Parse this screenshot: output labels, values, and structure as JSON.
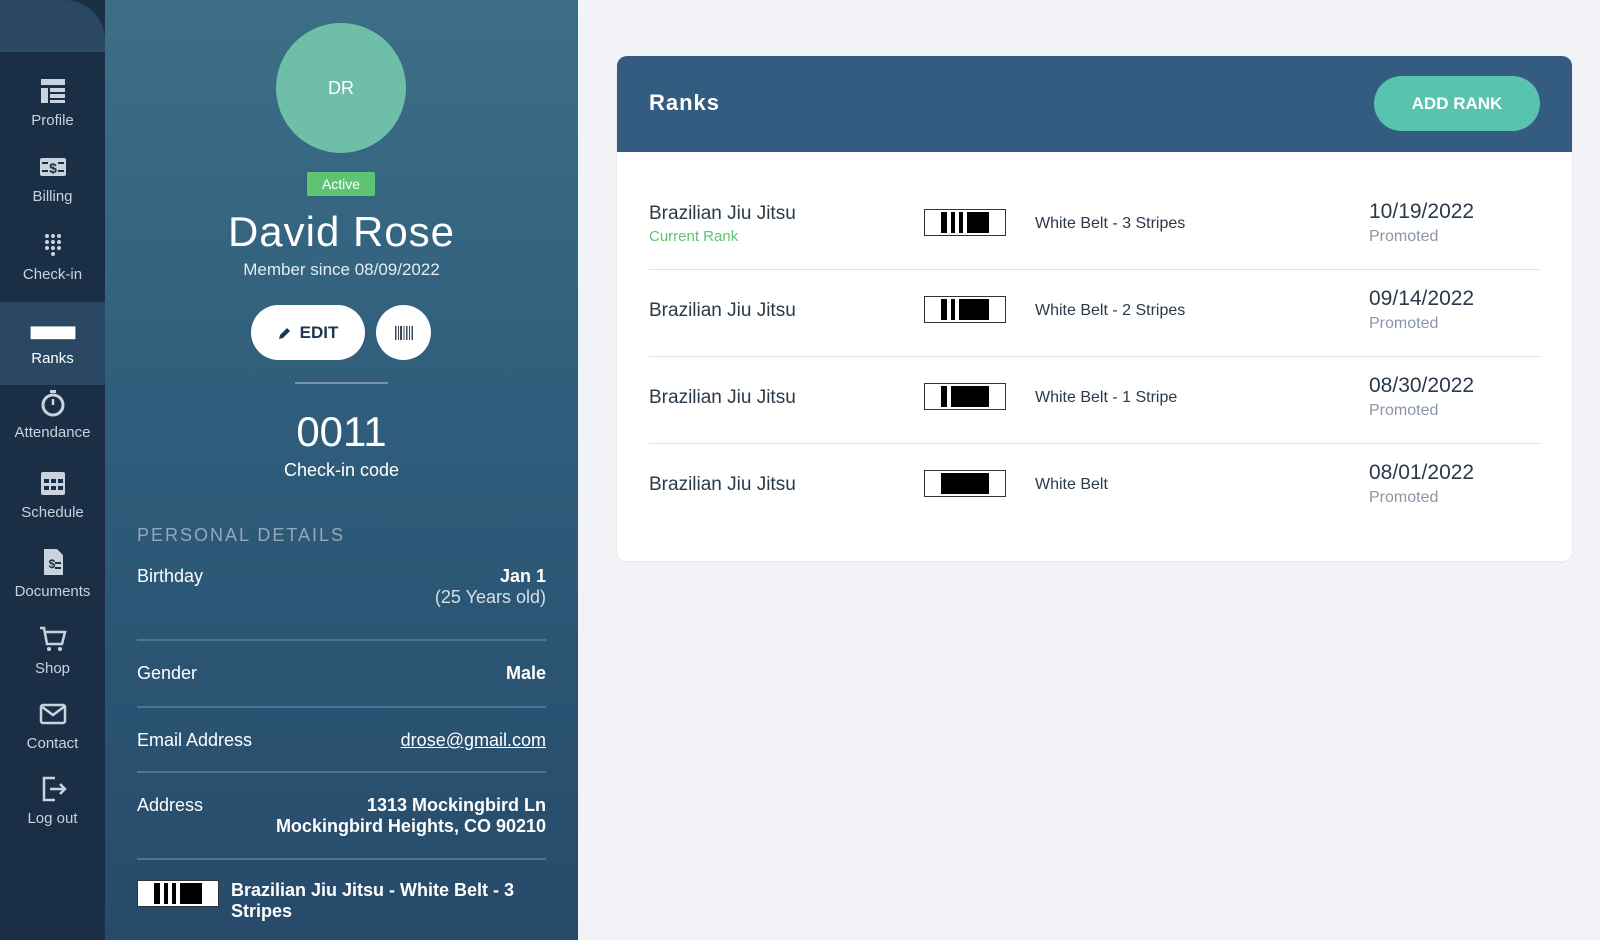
{
  "nav": {
    "items": [
      {
        "label": "Profile",
        "icon": "profile-icon"
      },
      {
        "label": "Billing",
        "icon": "billing-icon"
      },
      {
        "label": "Check-in",
        "icon": "keypad-icon"
      },
      {
        "label": "Ranks",
        "icon": "belt-icon"
      },
      {
        "label": "Attendance",
        "icon": "stopwatch-icon"
      },
      {
        "label": "Schedule",
        "icon": "calendar-icon"
      },
      {
        "label": "Documents",
        "icon": "document-icon"
      },
      {
        "label": "Shop",
        "icon": "cart-icon"
      },
      {
        "label": "Contact",
        "icon": "envelope-icon"
      },
      {
        "label": "Log out",
        "icon": "logout-icon"
      }
    ],
    "active": "Ranks"
  },
  "profile": {
    "initials": "DR",
    "status": "Active",
    "name": "David Rose",
    "member_since": "Member since 08/09/2022",
    "edit_label": "EDIT",
    "checkin_code": "0011",
    "checkin_label": "Check-in code",
    "section_heading": "PERSONAL DETAILS",
    "birthday_label": "Birthday",
    "birthday_value": "Jan 1",
    "birthday_age": "(25 Years old)",
    "gender_label": "Gender",
    "gender_value": "Male",
    "email_label": "Email Address",
    "email_value": "drose@gmail.com",
    "address_label": "Address",
    "address_line1": "1313 Mockingbird Ln",
    "address_line2": "Mockingbird Heights, CO 90210",
    "rank_summary": "Brazilian Jiu Jitsu - White Belt - 3 Stripes",
    "rank_summary_stripes": 3
  },
  "ranks_card": {
    "title": "Ranks",
    "add_button": "ADD RANK",
    "rows": [
      {
        "program": "Brazilian Jiu Jitsu",
        "current_label": "Current Rank",
        "belt_name": "White Belt - 3 Stripes",
        "stripes": 3,
        "date": "10/19/2022",
        "status": "Promoted"
      },
      {
        "program": "Brazilian Jiu Jitsu",
        "belt_name": "White Belt - 2 Stripes",
        "stripes": 2,
        "date": "09/14/2022",
        "status": "Promoted"
      },
      {
        "program": "Brazilian Jiu Jitsu",
        "belt_name": "White Belt - 1 Stripe",
        "stripes": 1,
        "date": "08/30/2022",
        "status": "Promoted"
      },
      {
        "program": "Brazilian Jiu Jitsu",
        "belt_name": "White Belt",
        "stripes": 0,
        "date": "08/01/2022",
        "status": "Promoted"
      }
    ]
  },
  "colors": {
    "nav_bg": "#1a2e45",
    "accent_teal": "#58c3ae",
    "active_green": "#5ec473",
    "card_header": "#335c80"
  }
}
